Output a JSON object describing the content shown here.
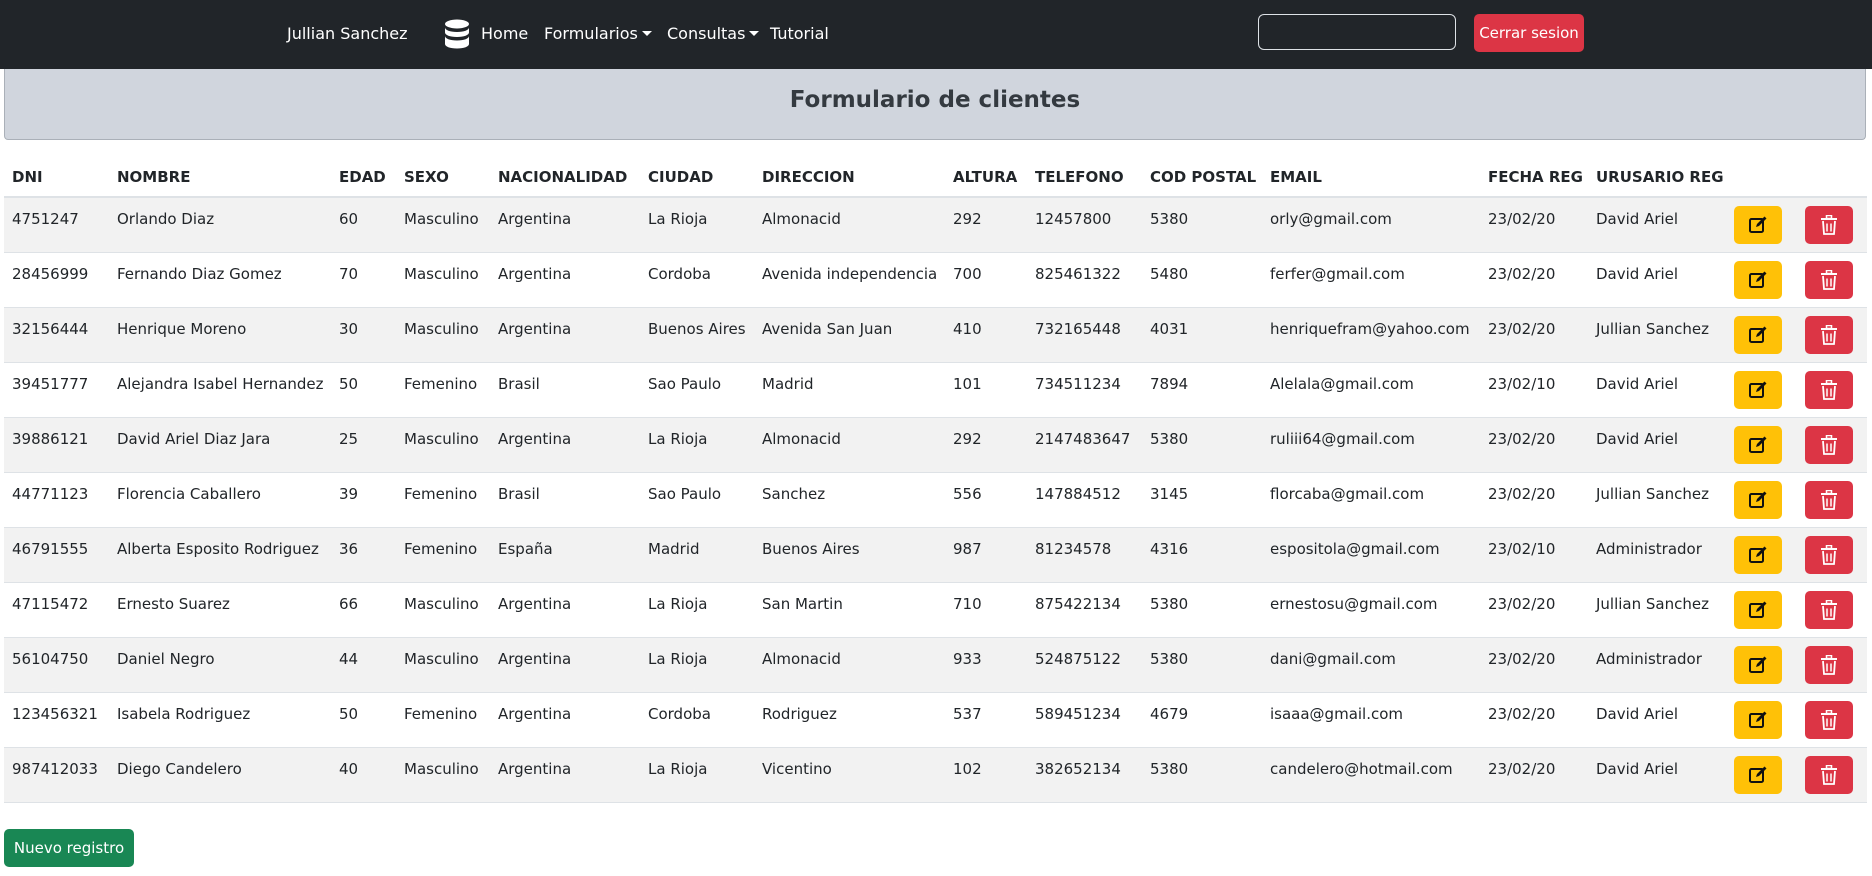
{
  "navbar": {
    "user_name": "Jullian Sanchez",
    "home_label": "Home",
    "formularios_label": "Formularios",
    "consultas_label": "Consultas",
    "tutorial_label": "Tutorial",
    "search_value": "",
    "logout_label": "Cerrar sesion",
    "icons": {
      "brand": "database-icon",
      "dropdown": "caret-down-icon"
    }
  },
  "page": {
    "title": "Formulario de clientes"
  },
  "table": {
    "columns": [
      "DNI",
      "NOMBRE",
      "EDAD",
      "SEXO",
      "NACIONALIDAD",
      "CIUDAD",
      "DIRECCION",
      "ALTURA",
      "TELEFONO",
      "COD POSTAL",
      "EMAIL",
      "FECHA REG",
      "URUSARIO REG"
    ],
    "rows": [
      {
        "dni": "4751247",
        "nombre": "Orlando Diaz",
        "edad": "60",
        "sexo": "Masculino",
        "nacionalidad": "Argentina",
        "ciudad": "La Rioja",
        "direccion": "Almonacid",
        "altura": "292",
        "telefono": "12457800",
        "cod_postal": "5380",
        "email": "orly@gmail.com",
        "fecha_reg": "23/02/20",
        "usuario_reg": "David Ariel"
      },
      {
        "dni": "28456999",
        "nombre": "Fernando Diaz Gomez",
        "edad": "70",
        "sexo": "Masculino",
        "nacionalidad": "Argentina",
        "ciudad": "Cordoba",
        "direccion": "Avenida independencia",
        "altura": "700",
        "telefono": "825461322",
        "cod_postal": "5480",
        "email": "ferfer@gmail.com",
        "fecha_reg": "23/02/20",
        "usuario_reg": "David Ariel"
      },
      {
        "dni": "32156444",
        "nombre": "Henrique Moreno",
        "edad": "30",
        "sexo": "Masculino",
        "nacionalidad": "Argentina",
        "ciudad": "Buenos Aires",
        "direccion": "Avenida San Juan",
        "altura": "410",
        "telefono": "732165448",
        "cod_postal": "4031",
        "email": "henriquefram@yahoo.com",
        "fecha_reg": "23/02/20",
        "usuario_reg": "Jullian Sanchez"
      },
      {
        "dni": "39451777",
        "nombre": "Alejandra Isabel Hernandez",
        "edad": "50",
        "sexo": "Femenino",
        "nacionalidad": "Brasil",
        "ciudad": "Sao Paulo",
        "direccion": "Madrid",
        "altura": "101",
        "telefono": "734511234",
        "cod_postal": "7894",
        "email": "Alelala@gmail.com",
        "fecha_reg": "23/02/10",
        "usuario_reg": "David Ariel"
      },
      {
        "dni": "39886121",
        "nombre": "David Ariel Diaz Jara",
        "edad": "25",
        "sexo": "Masculino",
        "nacionalidad": "Argentina",
        "ciudad": "La Rioja",
        "direccion": "Almonacid",
        "altura": "292",
        "telefono": "2147483647",
        "cod_postal": "5380",
        "email": "ruliii64@gmail.com",
        "fecha_reg": "23/02/20",
        "usuario_reg": "David Ariel"
      },
      {
        "dni": "44771123",
        "nombre": "Florencia Caballero",
        "edad": "39",
        "sexo": "Femenino",
        "nacionalidad": "Brasil",
        "ciudad": "Sao Paulo",
        "direccion": "Sanchez",
        "altura": "556",
        "telefono": "147884512",
        "cod_postal": "3145",
        "email": "florcaba@gmail.com",
        "fecha_reg": "23/02/20",
        "usuario_reg": "Jullian Sanchez"
      },
      {
        "dni": "46791555",
        "nombre": "Alberta Esposito Rodriguez",
        "edad": "36",
        "sexo": "Femenino",
        "nacionalidad": "España",
        "ciudad": "Madrid",
        "direccion": "Buenos Aires",
        "altura": "987",
        "telefono": "81234578",
        "cod_postal": "4316",
        "email": "espositola@gmail.com",
        "fecha_reg": "23/02/10",
        "usuario_reg": "Administrador"
      },
      {
        "dni": "47115472",
        "nombre": "Ernesto Suarez",
        "edad": "66",
        "sexo": "Masculino",
        "nacionalidad": "Argentina",
        "ciudad": "La Rioja",
        "direccion": "San Martin",
        "altura": "710",
        "telefono": "875422134",
        "cod_postal": "5380",
        "email": "ernestosu@gmail.com",
        "fecha_reg": "23/02/20",
        "usuario_reg": "Jullian Sanchez"
      },
      {
        "dni": "56104750",
        "nombre": "Daniel Negro",
        "edad": "44",
        "sexo": "Masculino",
        "nacionalidad": "Argentina",
        "ciudad": "La Rioja",
        "direccion": "Almonacid",
        "altura": "933",
        "telefono": "524875122",
        "cod_postal": "5380",
        "email": "dani@gmail.com",
        "fecha_reg": "23/02/20",
        "usuario_reg": "Administrador"
      },
      {
        "dni": "123456321",
        "nombre": "Isabela Rodriguez",
        "edad": "50",
        "sexo": "Femenino",
        "nacionalidad": "Argentina",
        "ciudad": "Cordoba",
        "direccion": "Rodriguez",
        "altura": "537",
        "telefono": "589451234",
        "cod_postal": "4679",
        "email": "isaaa@gmail.com",
        "fecha_reg": "23/02/20",
        "usuario_reg": "David Ariel"
      },
      {
        "dni": "987412033",
        "nombre": "Diego Candelero",
        "edad": "40",
        "sexo": "Masculino",
        "nacionalidad": "Argentina",
        "ciudad": "La Rioja",
        "direccion": "Vicentino",
        "altura": "102",
        "telefono": "382652134",
        "cod_postal": "5380",
        "email": "candelero@hotmail.com",
        "fecha_reg": "23/02/20",
        "usuario_reg": "David Ariel"
      }
    ],
    "row_actions": {
      "edit_icon": "edit-pencil-square-icon",
      "delete_icon": "trash-icon"
    }
  },
  "footer": {
    "new_record_label": "Nuevo registro"
  },
  "colors": {
    "navbar_bg": "#212529",
    "danger": "#dc3545",
    "warning": "#ffc107",
    "success": "#198754",
    "header_panel": "#d0d5dd"
  }
}
